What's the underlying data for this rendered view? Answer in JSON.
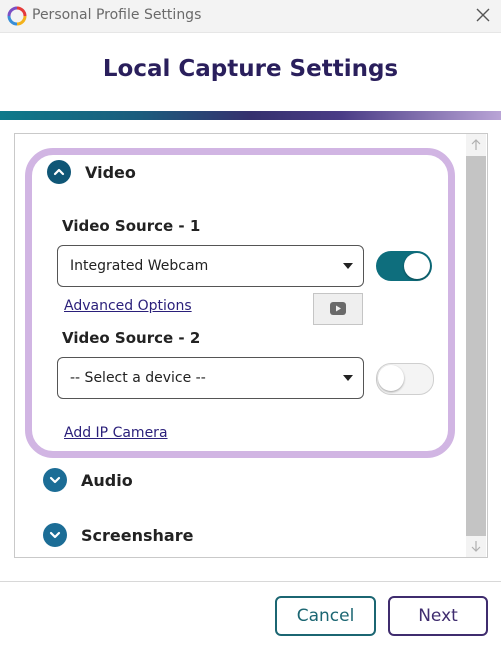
{
  "window": {
    "title": "Personal Profile Settings",
    "logo_icon": "app-swirl-logo",
    "close_icon": "close-icon"
  },
  "page": {
    "title": "Local Capture Settings"
  },
  "sections": {
    "video": {
      "label": "Video",
      "expanded": true,
      "sources": [
        {
          "label": "Video Source - 1",
          "selected": "Integrated Webcam",
          "toggle_on": true,
          "advanced_link": "Advanced Options",
          "preview_icon": "play-icon"
        },
        {
          "label": "Video Source - 2",
          "selected": "-- Select a device --",
          "toggle_on": false
        }
      ],
      "add_ip_camera": "Add IP Camera"
    },
    "audio": {
      "label": "Audio",
      "expanded": false
    },
    "screenshare": {
      "label": "Screenshare",
      "expanded": false
    }
  },
  "footer": {
    "cancel_label": "Cancel",
    "next_label": "Next"
  },
  "colors": {
    "title": "#2a1f5c",
    "accent_teal": "#0e6e7d",
    "card_border": "#d1b5e3",
    "chevron_bg": "#1c6d96"
  }
}
